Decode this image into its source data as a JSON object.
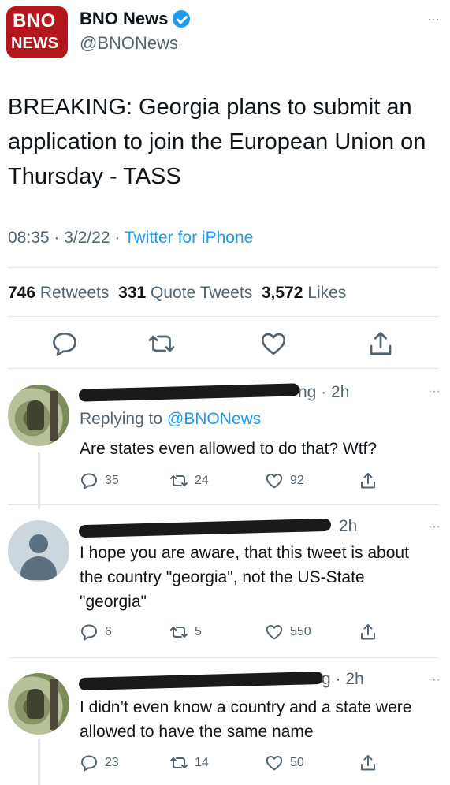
{
  "author": {
    "logo_line1": "BNO",
    "logo_line2": "NEWS",
    "name": "BNO News",
    "handle": "@BNONews",
    "more": "···"
  },
  "tweet": {
    "text": "BREAKING: Georgia plans to submit an application to join the European Union on Thursday - TASS",
    "time": "08:35 · 3/2/22 · ",
    "source": "Twitter for iPhone",
    "retweets_count": "746",
    "retweets_label": "Retweets",
    "quotes_count": "331",
    "quotes_label": "Quote Tweets",
    "likes_count": "3,572",
    "likes_label": "Likes"
  },
  "icons": {
    "reply": "reply-icon",
    "retweet": "retweet-icon",
    "like": "heart-icon",
    "share": "share-icon",
    "more": "more-icon",
    "verified": "verified-icon"
  },
  "colors": {
    "brand_red": "#b3161b",
    "link_blue": "#1d9bf0",
    "muted": "#536471"
  },
  "replies": [
    {
      "time_fragment": "ng · 2h",
      "replying_prefix": "Replying to ",
      "replying_mention": "@BNONews",
      "text": "Are states even allowed to do that? Wtf?",
      "replies": "35",
      "retweets": "24",
      "likes": "92"
    },
    {
      "time_fragment": "2h",
      "text": "I hope you are aware, that this tweet is about the country \"georgia\", not the US-State \"georgia\"",
      "replies": "6",
      "retweets": "5",
      "likes": "550"
    },
    {
      "time_fragment": "g · 2h",
      "text": "I didn’t even know a country and a state were allowed to have the same name",
      "replies": "23",
      "retweets": "14",
      "likes": "50"
    }
  ]
}
